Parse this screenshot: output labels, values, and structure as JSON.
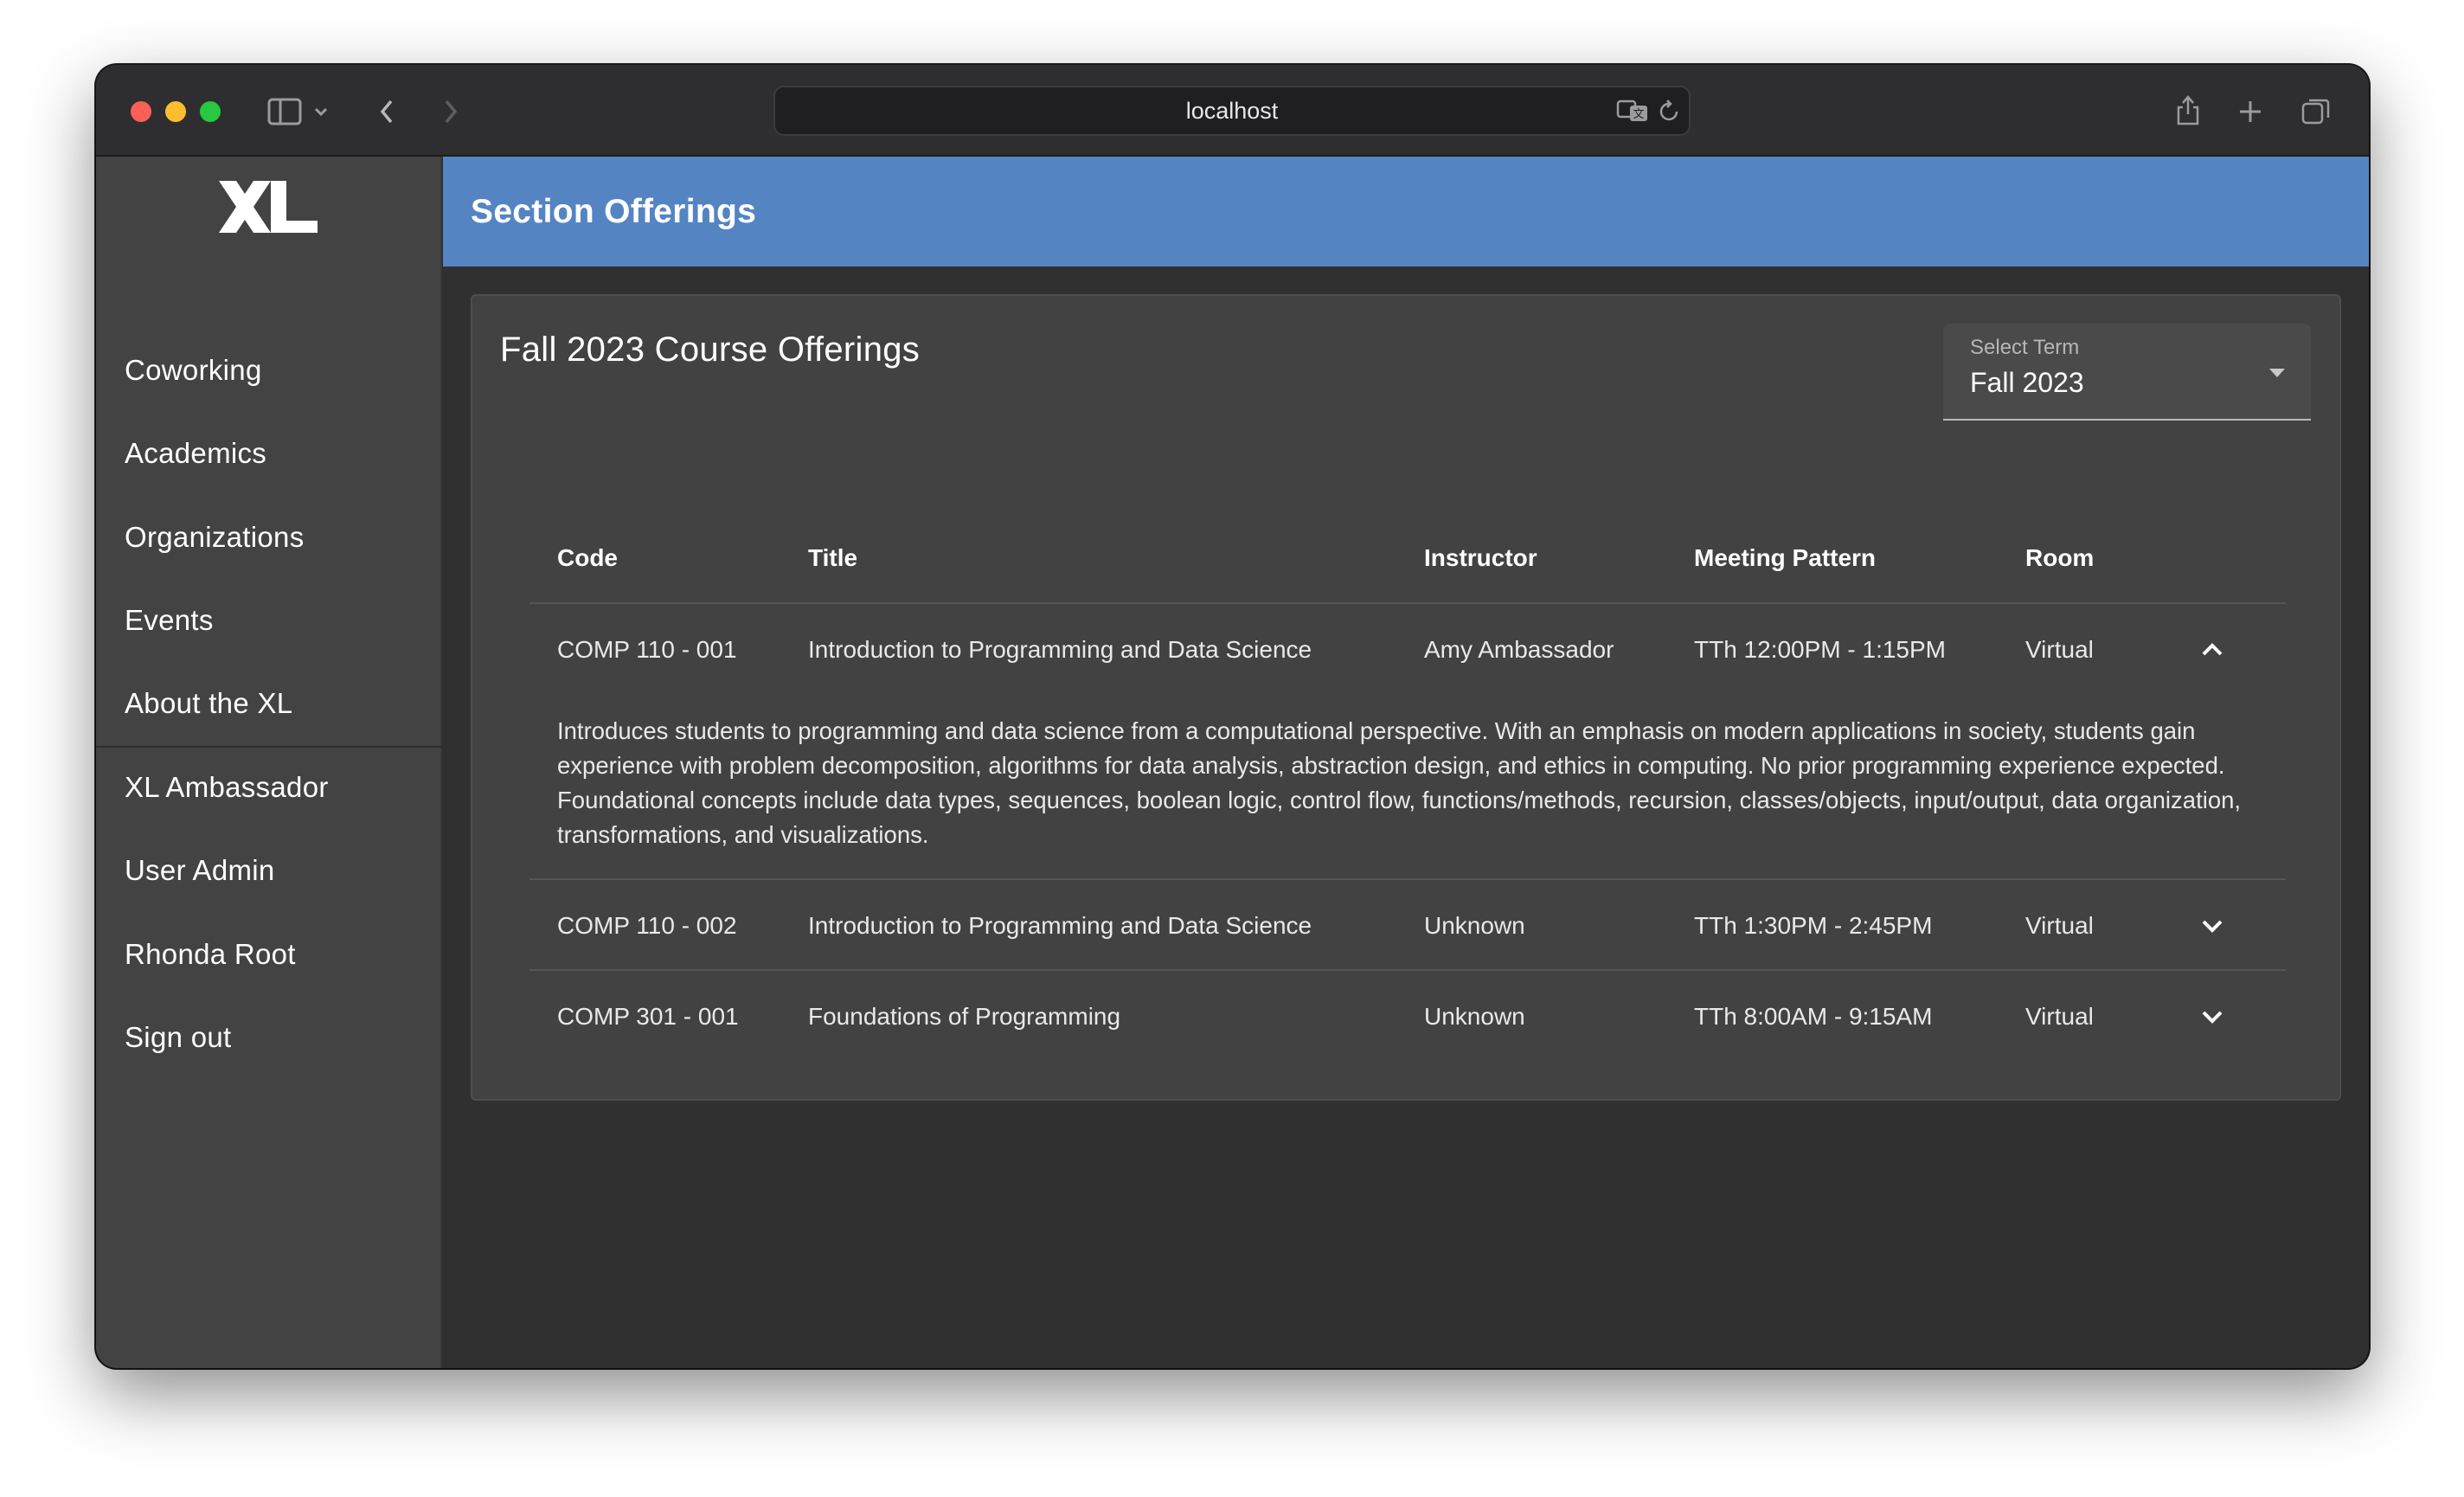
{
  "browser": {
    "url": "localhost"
  },
  "sidebar": {
    "logo_text": "XL",
    "items": [
      {
        "label": "Coworking"
      },
      {
        "label": "Academics"
      },
      {
        "label": "Organizations"
      },
      {
        "label": "Events"
      },
      {
        "label": "About the XL"
      },
      {
        "label": "XL Ambassador"
      },
      {
        "label": "User Admin"
      },
      {
        "label": "Rhonda Root"
      },
      {
        "label": "Sign out"
      }
    ]
  },
  "header": {
    "title": "Section Offerings",
    "color": "#5584c3"
  },
  "card": {
    "title": "Fall 2023 Course Offerings",
    "term_select": {
      "label": "Select Term",
      "value": "Fall 2023"
    },
    "table": {
      "columns": [
        "Code",
        "Title",
        "Instructor",
        "Meeting Pattern",
        "Room"
      ],
      "rows": [
        {
          "code": "COMP 110 - 001",
          "title": "Introduction to Programming and Data Science",
          "instructor": "Amy Ambassador",
          "meeting": "TTh 12:00PM - 1:15PM",
          "room": "Virtual",
          "expanded": true,
          "description": "Introduces students to programming and data science from a computational perspective. With an emphasis on modern applications in society, students gain experience with problem decomposition, algorithms for data analysis, abstraction design, and ethics in computing. No prior programming experience expected. Foundational concepts include data types, sequences, boolean logic, control flow, functions/methods, recursion, classes/objects, input/output, data organization, transformations, and visualizations."
        },
        {
          "code": "COMP 110 - 002",
          "title": "Introduction to Programming and Data Science",
          "instructor": "Unknown",
          "meeting": "TTh 1:30PM - 2:45PM",
          "room": "Virtual",
          "expanded": false
        },
        {
          "code": "COMP 301 - 001",
          "title": "Foundations of Programming",
          "instructor": "Unknown",
          "meeting": "TTh 8:00AM - 9:15AM",
          "room": "Virtual",
          "expanded": false
        }
      ]
    }
  },
  "icons": {
    "sidebar_toggle": "sidebar-icon",
    "back": "chevron-left-icon",
    "forward": "chevron-right-icon",
    "translate": "translate-icon",
    "reload": "reload-icon",
    "share": "share-icon",
    "new_tab": "plus-icon",
    "tabs": "tabs-overview-icon"
  }
}
